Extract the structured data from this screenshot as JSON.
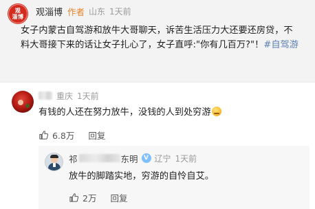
{
  "post": {
    "avatar_text_top": "观",
    "avatar_text_bottom": "淄博",
    "author": "观淄博",
    "author_tag": "作者",
    "location": "山东",
    "time": "1天前",
    "text": "女子内蒙古自驾游和放牛大哥聊天，诉苦生活压力大还要还房贷，不料大哥接下来的话让女子扎心了，女子直呼:\"你有几百万?\"！",
    "hashtag": "#自驾游"
  },
  "comments": [
    {
      "location": "重庆",
      "time": "1天前",
      "text": "有钱的人还在努力放牛，没钱的人到处穷游",
      "likes": "6.8万",
      "reply_label": "回复",
      "replies": [
        {
          "name_prefix": "祁",
          "name_suffix": "东明",
          "verified_icon": "v-verified-icon",
          "location": "辽宁",
          "time": "1天前",
          "text": "放牛的脚踏实地，穷游的自怜自艾。",
          "likes": "2万",
          "reply_label": "回复"
        }
      ]
    }
  ],
  "icons": {
    "like": "thumbs-up-icon",
    "emoji": "awkward-emoji-icon"
  },
  "colors": {
    "author_tag": "#e8842a",
    "hashtag": "#5b7fb6",
    "meta_gray": "#9a9a9a",
    "post_bg": "#f3f3f3"
  }
}
